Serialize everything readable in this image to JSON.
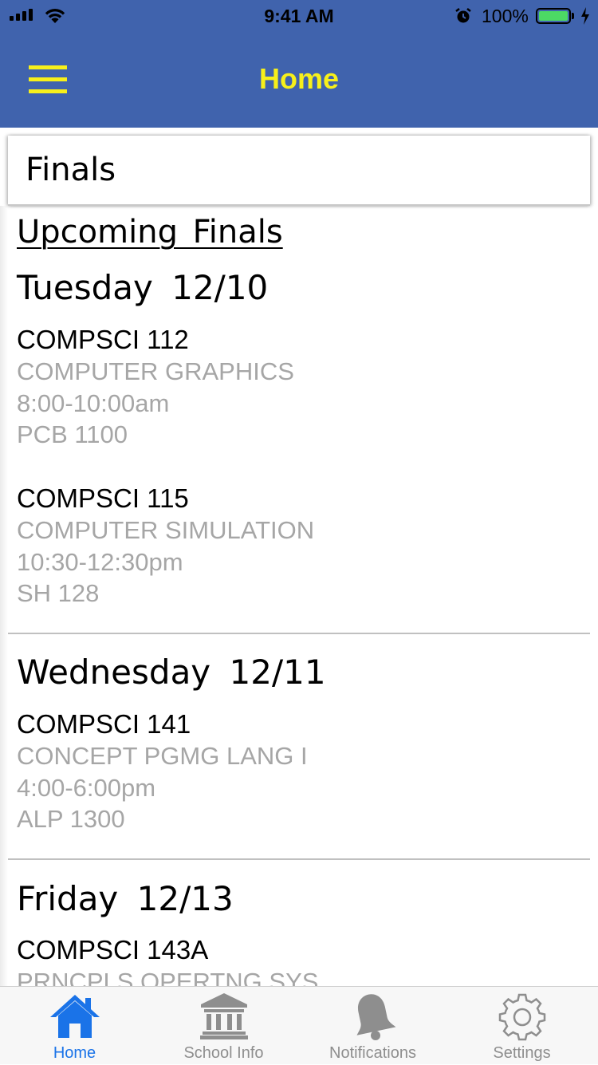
{
  "status_bar": {
    "time": "9:41 AM",
    "battery_percent": "100%",
    "battery_level": 1.0,
    "icons": [
      "signal-icon",
      "wifi-icon",
      "alarm-icon",
      "battery-icon",
      "charging-icon"
    ]
  },
  "nav": {
    "title": "Home",
    "menu_icon": "hamburger-menu-icon",
    "background_color": "#4063ad",
    "title_color": "#f7f01a"
  },
  "section": {
    "title": "Finals"
  },
  "finals": {
    "heading": "Upcoming Finals",
    "days": [
      {
        "day": "Tuesday 12/10",
        "courses": [
          {
            "code": "COMPSCI 112",
            "name": "COMPUTER GRAPHICS",
            "time": "8:00-10:00am",
            "room": "PCB 1100"
          },
          {
            "code": "COMPSCI 115",
            "name": "COMPUTER SIMULATION",
            "time": "10:30-12:30pm",
            "room": "SH 128"
          }
        ]
      },
      {
        "day": "Wednesday 12/11",
        "courses": [
          {
            "code": "COMPSCI 141",
            "name": "CONCEPT PGMG LANG I",
            "time": "4:00-6:00pm",
            "room": "ALP 1300"
          }
        ]
      },
      {
        "day": "Friday 12/13",
        "courses": [
          {
            "code": "COMPSCI 143A",
            "name": "PRNCPLS OPERTNG SYS",
            "time": "",
            "room": ""
          }
        ]
      }
    ]
  },
  "tabs": [
    {
      "label": "Home",
      "icon": "house-icon",
      "active": true
    },
    {
      "label": "School Info",
      "icon": "school-building-icon",
      "active": false
    },
    {
      "label": "Notifications",
      "icon": "bell-icon",
      "active": false
    },
    {
      "label": "Settings",
      "icon": "gear-icon",
      "active": false
    }
  ],
  "colors": {
    "active_tab": "#1a73e8",
    "inactive_tab": "#8e8e8e",
    "detail_text": "#a6a6a6"
  }
}
